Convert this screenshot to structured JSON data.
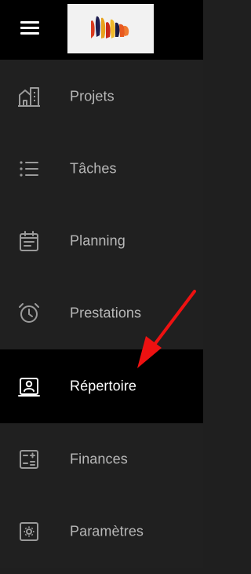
{
  "header": {
    "menu_icon": "hamburger-icon",
    "logo_colors": [
      "#e04020",
      "#f0b020",
      "#202060",
      "#f06020"
    ]
  },
  "nav": {
    "items": [
      {
        "label": "Projets",
        "icon": "building-icon",
        "active": false
      },
      {
        "label": "Tâches",
        "icon": "list-icon",
        "active": false
      },
      {
        "label": "Planning",
        "icon": "calendar-icon",
        "active": false
      },
      {
        "label": "Prestations",
        "icon": "alarm-clock-icon",
        "active": false
      },
      {
        "label": "Répertoire",
        "icon": "contact-card-icon",
        "active": true
      },
      {
        "label": "Finances",
        "icon": "calculator-icon",
        "active": false
      },
      {
        "label": "Paramètres",
        "icon": "settings-icon",
        "active": false
      }
    ]
  },
  "colors": {
    "sidebar_bg": "#1f1f1f",
    "active_bg": "#000000",
    "text_inactive": "#b8b8b8",
    "text_active": "#ffffff",
    "annotation_arrow": "#ee1111"
  }
}
